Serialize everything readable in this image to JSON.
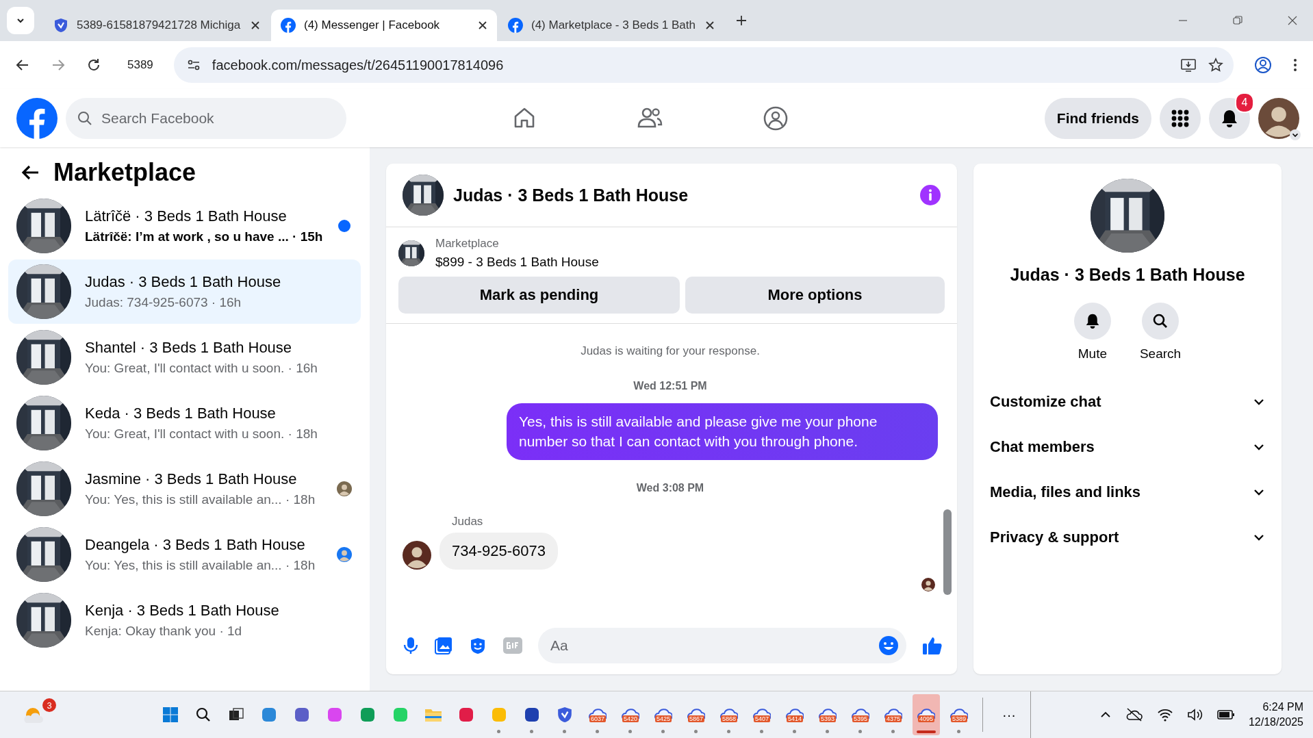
{
  "browser": {
    "tabs": [
      {
        "title": "5389-61581879421728 Michiga",
        "selected": false
      },
      {
        "title": "(4) Messenger | Facebook",
        "selected": true
      },
      {
        "title": "(4) Marketplace - 3 Beds 1 Bath",
        "selected": false
      }
    ],
    "profile_label": "5389",
    "url": "facebook.com/messages/t/26451190017814096"
  },
  "header": {
    "search": {
      "placeholder": "Search Facebook"
    },
    "find_friends": "Find friends",
    "notification_count": "4"
  },
  "sidebar": {
    "title": "Marketplace",
    "conversations": [
      {
        "title": "Lätrîčë · 3 Beds 1 Bath House",
        "preview": "Lätrîčë: I’m at work , so u have ... · 15h",
        "unread": true,
        "selected": false,
        "seen": false
      },
      {
        "title": "Judas · 3 Beds 1 Bath House",
        "preview": "Judas: 734-925-6073 · 16h",
        "unread": false,
        "selected": true,
        "seen": false
      },
      {
        "title": "Shantel · 3 Beds 1 Bath House",
        "preview": "You: Great, I'll contact with u soon. · 16h",
        "unread": false,
        "selected": false,
        "seen": false
      },
      {
        "title": "Keda · 3 Beds 1 Bath House",
        "preview": "You: Great, I'll contact with u soon. · 18h",
        "unread": false,
        "selected": false,
        "seen": false
      },
      {
        "title": "Jasmine · 3 Beds 1 Bath House",
        "preview": "You: Yes, this is still available an... · 18h",
        "unread": false,
        "selected": false,
        "seen": true
      },
      {
        "title": "Deangela · 3 Beds 1 Bath House",
        "preview": "You: Yes, this is still available an... · 18h",
        "unread": false,
        "selected": false,
        "seen": true
      },
      {
        "title": "Kenja · 3 Beds 1 Bath House",
        "preview": "Kenja: Okay thank you · 1d",
        "unread": false,
        "selected": false,
        "seen": false
      }
    ]
  },
  "chat": {
    "title": "Judas · 3 Beds 1 Bath House",
    "listing": {
      "label": "Marketplace",
      "title": "$899 - 3 Beds 1 Bath House"
    },
    "actions": [
      "Mark as pending",
      "More options"
    ],
    "messages": [
      {
        "kind": "notice",
        "text": "Judas is waiting for your response."
      },
      {
        "kind": "timestamp",
        "text": "Wed 12:51 PM"
      },
      {
        "kind": "outgoing",
        "text": "Yes, this is still available and please give me your phone number so that I can contact with you through phone."
      },
      {
        "kind": "timestamp",
        "text": "Wed 3:08 PM"
      },
      {
        "kind": "sender",
        "text": "Judas"
      },
      {
        "kind": "incoming",
        "text": "734-925-6073"
      }
    ],
    "composer": {
      "placeholder": "Aa"
    }
  },
  "details": {
    "name": "Judas · 3 Beds 1 Bath House",
    "actions": [
      {
        "label": "Mute"
      },
      {
        "label": "Search"
      }
    ],
    "sections": [
      {
        "label": "Customize chat",
        "expanded": false
      },
      {
        "label": "Chat members",
        "expanded": false
      },
      {
        "label": "Media, files and links",
        "expanded": false
      },
      {
        "label": "Privacy & support",
        "expanded": false
      }
    ]
  },
  "taskbar": {
    "weather_badge": "3",
    "apps": [
      {
        "kind": "start"
      },
      {
        "kind": "search"
      },
      {
        "kind": "taskview"
      },
      {
        "kind": "app",
        "color": "#2b88d8"
      },
      {
        "kind": "app",
        "color": "#5b5fc7"
      },
      {
        "kind": "app",
        "color": "#d946ef"
      },
      {
        "kind": "app",
        "color": "#0f9d58"
      },
      {
        "kind": "app",
        "color": "#25d366"
      },
      {
        "kind": "folder"
      },
      {
        "kind": "app",
        "color": "#e11d48"
      },
      {
        "kind": "app",
        "color": "#fbbc05",
        "running": true
      },
      {
        "kind": "app",
        "color": "#1e40af",
        "running": true
      },
      {
        "kind": "shield",
        "running": true
      },
      {
        "kind": "cloud",
        "label": "6037",
        "running": true,
        "selected": false
      },
      {
        "kind": "cloud",
        "label": "5420",
        "running": true,
        "selected": false
      },
      {
        "kind": "cloud",
        "label": "5425",
        "running": true,
        "selected": false
      },
      {
        "kind": "cloud",
        "label": "5867",
        "running": true,
        "selected": false
      },
      {
        "kind": "cloud",
        "label": "5868",
        "running": true,
        "selected": false
      },
      {
        "kind": "cloud",
        "label": "5407",
        "running": true,
        "selected": false
      },
      {
        "kind": "cloud",
        "label": "5414",
        "running": true,
        "selected": false
      },
      {
        "kind": "cloud",
        "label": "5393",
        "running": true,
        "selected": false
      },
      {
        "kind": "cloud",
        "label": "5395",
        "running": true,
        "selected": false
      },
      {
        "kind": "cloud",
        "label": "4375",
        "running": true,
        "selected": false
      },
      {
        "kind": "cloud",
        "label": "4095",
        "running": true,
        "selected": true
      },
      {
        "kind": "cloud",
        "label": "5389",
        "running": true,
        "selected": false
      }
    ],
    "more": "···",
    "time": "6:24 PM",
    "date": "12/18/2025"
  }
}
